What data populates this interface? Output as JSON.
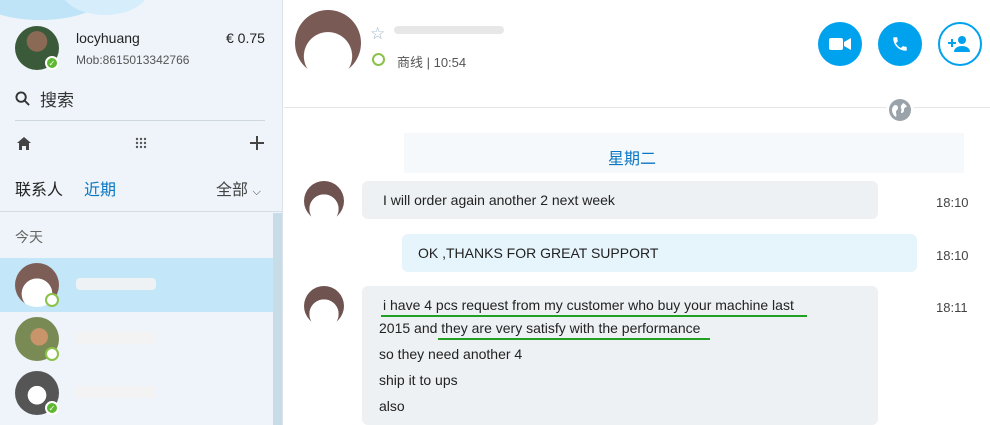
{
  "profile": {
    "name": "locyhuang",
    "mob": "Mob:8615013342766",
    "credit": "€ 0.75"
  },
  "search": {
    "label": "搜索"
  },
  "tabs": {
    "contacts": "联系人",
    "recent": "近期",
    "filter": "全部"
  },
  "sections": {
    "today": "今天"
  },
  "header": {
    "presence": "商线 | 10:54"
  },
  "chat": {
    "day_label": "星期二",
    "messages": [
      {
        "direction": "in",
        "text": "I will order again another 2 next week",
        "time": "18:10"
      },
      {
        "direction": "out",
        "text": "OK ,THANKS FOR GREAT SUPPORT",
        "time": "18:10"
      },
      {
        "direction": "in",
        "time": "18:11",
        "lines": [
          "i have 4 pcs request from my customer who buy your machine last",
          "2015 and they are very satisfy with the performance",
          "so they need another 4",
          "ship it to ups",
          "also"
        ]
      }
    ]
  },
  "colors": {
    "accent": "#00a2ed",
    "link": "#0b77c2",
    "online": "#5fb832",
    "underline": "#22a022"
  }
}
